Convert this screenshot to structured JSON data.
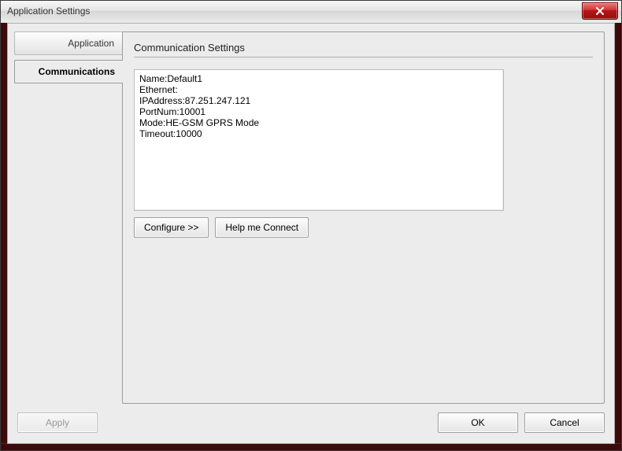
{
  "window": {
    "title": "Application Settings"
  },
  "tabs": {
    "application": "Application",
    "communications": "Communications"
  },
  "page": {
    "heading": "Communication Settings",
    "info": "Name:Default1\nEthernet:\nIPAddress:87.251.247.121\nPortNum:10001\nMode:HE-GSM GPRS Mode\nTimeout:10000",
    "configure": "Configure >>",
    "help_connect": "Help me Connect"
  },
  "footer": {
    "apply": "Apply",
    "ok": "OK",
    "cancel": "Cancel"
  }
}
